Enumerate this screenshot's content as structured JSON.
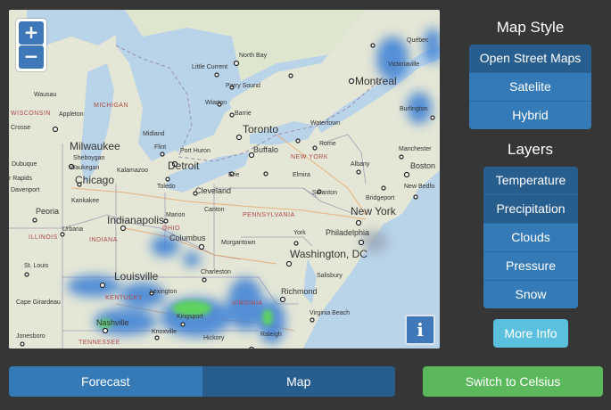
{
  "map": {
    "zoom_in_label": "+",
    "zoom_out_label": "−",
    "info_label": "i",
    "labels": {
      "quebec": "Québec",
      "victoriaville": "Victoriaville",
      "north_bay": "North Bay",
      "montreal": "Montreal",
      "little_current": "Little Current",
      "parry_sound": "Parry Sound",
      "wiarton": "Wiarton",
      "barrie": "Barrie",
      "wausau": "Wausau",
      "wisconsin": "WISCONSIN",
      "michigan": "MICHIGAN",
      "appleton": "Appleton",
      "toronto": "Toronto",
      "burlington": "Burlington",
      "midland": "Midland",
      "watertown": "Watertown",
      "crosse": "Crosse",
      "milwaukee": "Milwaukee",
      "flint": "Flint",
      "port_huron": "Port Huron",
      "buffalo": "Buffalo",
      "rome": "Rome",
      "manchester": "Manchester",
      "sheboygan": "Sheboygan",
      "new_york_state": "NEW YORK",
      "dubuque": "Dubuque",
      "waukegan": "Waukegan",
      "kalamazoo": "Kalamazoo",
      "detroit": "Detroit",
      "elmira": "Elmira",
      "albany": "Albany",
      "boston": "Boston",
      "rapids": "r Rapids",
      "chicago": "Chicago",
      "erie": "Erie",
      "new_bedford": "New Bedfo",
      "davenport": "Davenport",
      "toledo": "Toledo",
      "cleveland": "Cleveland",
      "scranton": "Scranton",
      "bridgeport": "Bridgeport",
      "kankakee": "Kankakee",
      "new_york": "New York",
      "peoria": "Peoria",
      "indianapolis": "Indianapolis",
      "marion": "Marion",
      "canton": "Canton",
      "pennsylvania": "PENNSYLVANIA",
      "urbana": "Urbana",
      "illinois": "ILLINOIS",
      "ohio": "OHIO",
      "york": "York",
      "philadelphia": "Philadelphia",
      "indiana": "INDIANA",
      "columbus": "Columbus",
      "morgantown": "Morgantown",
      "washington_dc": "Washington, DC",
      "st_louis": "St. Louis",
      "louisville": "Louisville",
      "charleston": "Charleston",
      "salisbury": "Salisbury",
      "cape_girardeau": "Cape Girardeau",
      "lexington": "Lexington",
      "richmond": "Richmond",
      "virginia": "VIRGINIA",
      "kentucky": "KENTUCKY",
      "virginia_beach": "Virginia Beach",
      "kingsport": "Kingsport",
      "nashville": "Nashville",
      "knoxville": "Knoxville",
      "raleigh": "Raleigh",
      "jonesboro": "Jonesboro",
      "tennessee": "TENNESSEE",
      "hickory": "Hickory"
    }
  },
  "map_style": {
    "title": "Map Style",
    "options": [
      "Open Street Maps",
      "Satelite",
      "Hybrid"
    ],
    "active": "Open Street Maps"
  },
  "layers": {
    "title": "Layers",
    "options": [
      "Temperature",
      "Precipitation",
      "Clouds",
      "Pressure",
      "Snow"
    ],
    "active": [
      "Temperature",
      "Precipitation"
    ]
  },
  "more_info_label": "More Info",
  "bottom_tabs": {
    "forecast": "Forecast",
    "map": "Map"
  },
  "switch_units_label": "Switch to Celsius",
  "colors": {
    "primary": "#337ab7",
    "primary_active": "#285e8e",
    "info": "#5bc0de",
    "success": "#5cb85c",
    "background": "#363636",
    "water": "#b9d3e8",
    "land": "#e3e6d8",
    "precip_blue": "#3a7fd6",
    "precip_green": "#5fd35f"
  }
}
